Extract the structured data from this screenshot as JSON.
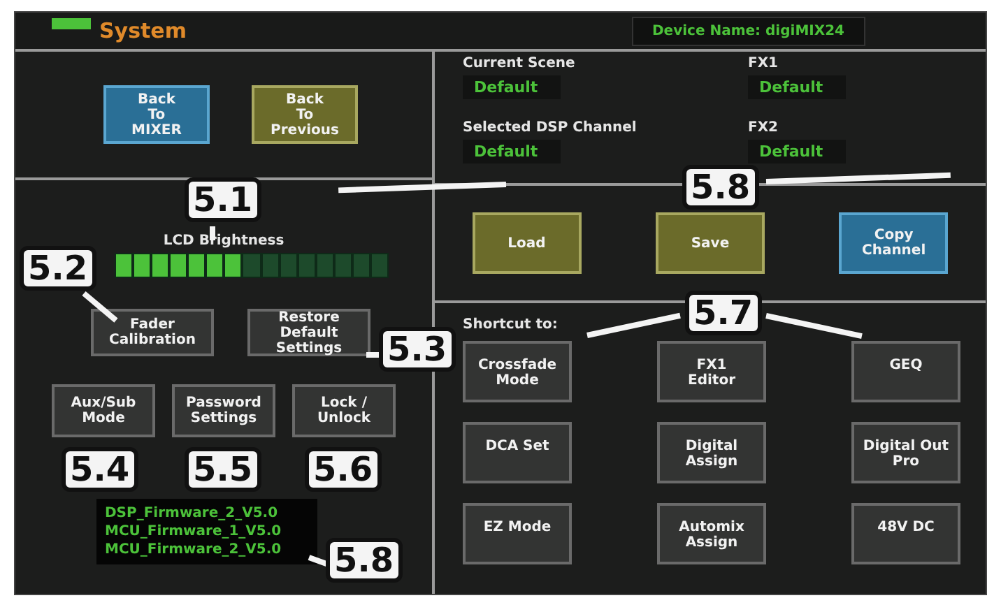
{
  "title_bar": {
    "title": "System",
    "device_name": "Device Name: digiMIX24"
  },
  "nav_buttons": [
    {
      "label": "Back\nTo\nMIXER",
      "kind": "blue"
    },
    {
      "label": "Back\nTo\nPrevious",
      "kind": "olive"
    }
  ],
  "brightness": {
    "label": "LCD Brightness",
    "level": 0.467
  },
  "system_buttons": [
    {
      "label": "Fader\nCalibration"
    },
    {
      "label": "Restore\nDefault Settings"
    }
  ],
  "mode_buttons": [
    {
      "label": "Aux/Sub\nMode"
    },
    {
      "label": "Password\nSettings"
    },
    {
      "label": "Lock /\nUnlock"
    }
  ],
  "firmware": [
    "DSP_Firmware_2_V5.0",
    "MCU_Firmware_1_V5.0",
    "MCU_Firmware_2_V5.0"
  ],
  "status": [
    {
      "label": "Current Scene",
      "value": "Default"
    },
    {
      "label": "FX1",
      "value": "Default"
    },
    {
      "label": "Selected DSP Channel",
      "value": "Default"
    },
    {
      "label": "FX2",
      "value": "Default"
    }
  ],
  "scene_buttons": [
    {
      "label": "Load",
      "kind": "olive"
    },
    {
      "label": "Save",
      "kind": "olive"
    },
    {
      "label": "Copy\nChannel",
      "kind": "blue"
    }
  ],
  "shortcut": {
    "label": "Shortcut to:",
    "buttons": [
      "Crossfade\nMode",
      "FX1\nEditor",
      "GEQ",
      "DCA Set",
      "Digital\nAssign",
      "Digital Out\nPro",
      "EZ Mode",
      "Automix\nAssign",
      "48V DC"
    ]
  },
  "callouts": [
    "5.1",
    "5.2",
    "5.3",
    "5.4",
    "5.5",
    "5.6",
    "5.8",
    "5.8",
    "5.7"
  ]
}
